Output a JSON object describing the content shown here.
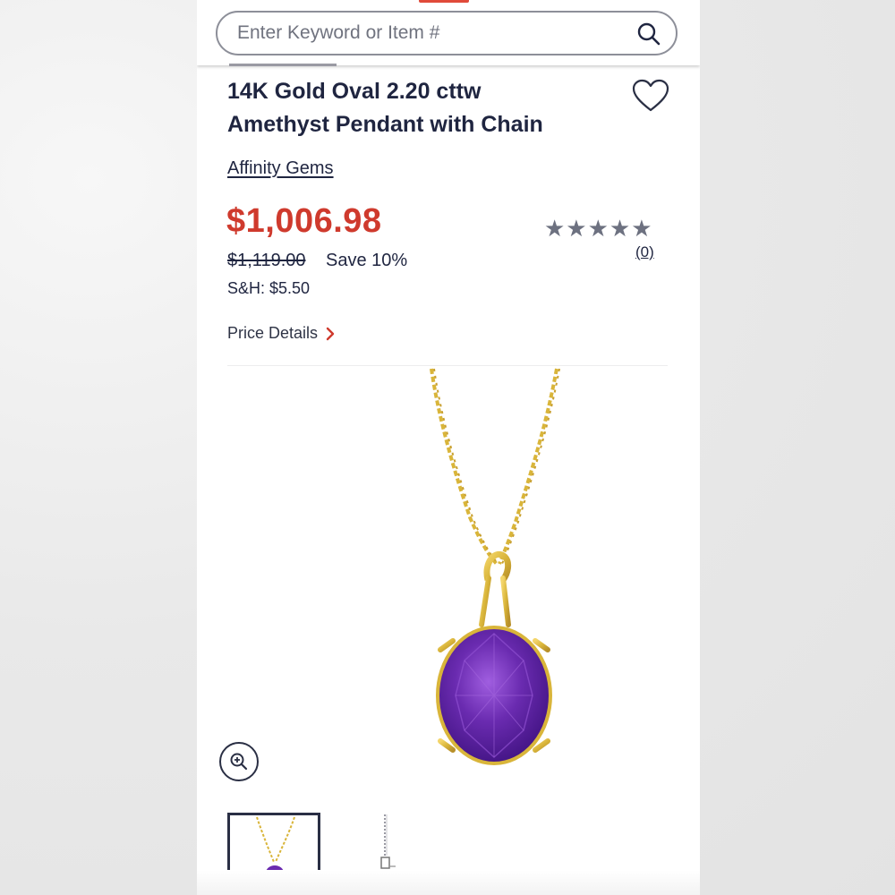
{
  "search": {
    "placeholder": "Enter Keyword or Item #",
    "value": ""
  },
  "product": {
    "title_line1": "14K Gold Oval 2.20 cttw",
    "title_line2": "Amethyst Pendant with Chain",
    "brand": "Affinity Gems",
    "price": "$1,006.98",
    "original_price": "$1,119.00",
    "savings": "Save 10%",
    "shipping": "S&H: $5.50",
    "rating_stars": "★★★★★",
    "rating_value": 0,
    "review_count": "(0)",
    "price_details_label": "Price Details"
  },
  "colors": {
    "price_red": "#cf3a2d",
    "text_navy": "#1f2540",
    "star_gray": "#6d7180",
    "amethyst": "#6a2bb0",
    "gold": "#d9b53a"
  },
  "icons": {
    "search": "search-icon",
    "favorite": "heart-icon",
    "chevron": "chevron-right-icon",
    "zoom": "zoom-in-icon"
  }
}
